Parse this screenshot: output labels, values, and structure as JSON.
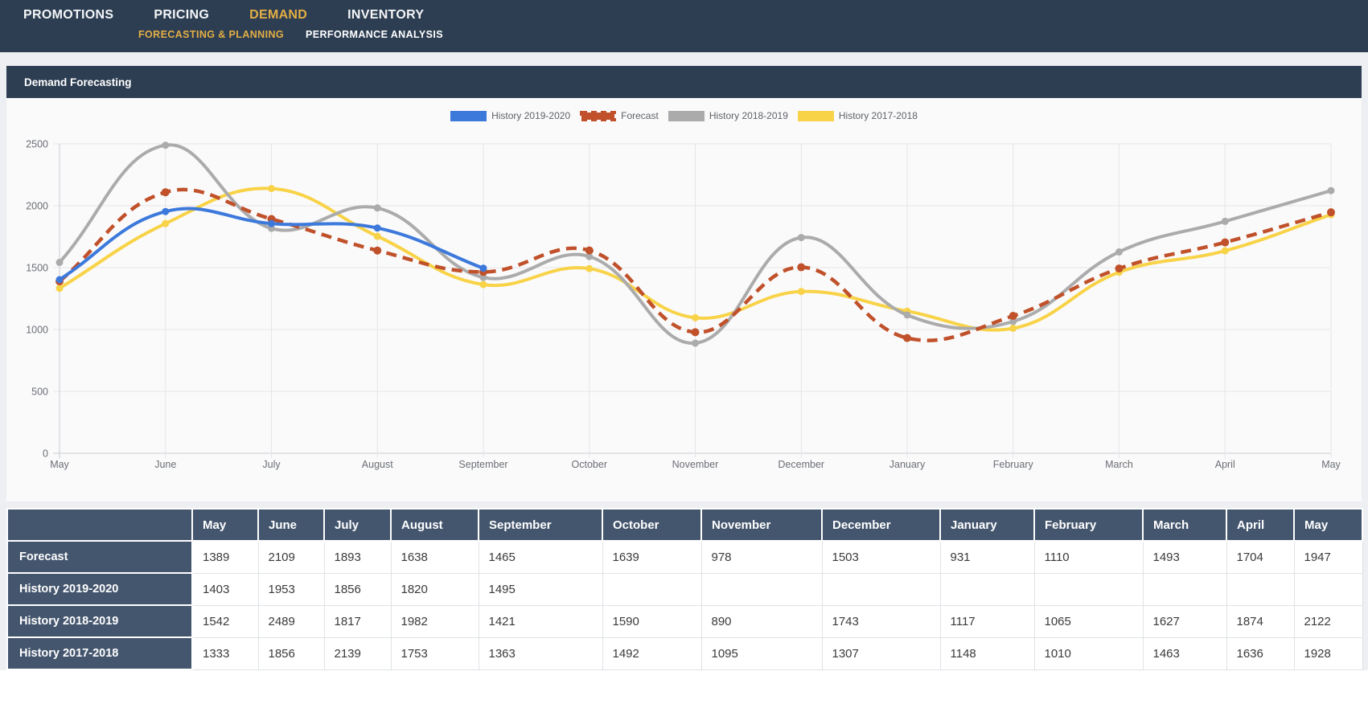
{
  "nav": {
    "items": [
      {
        "label": "PROMOTIONS",
        "active": false
      },
      {
        "label": "PRICING",
        "active": false
      },
      {
        "label": "DEMAND",
        "active": true
      },
      {
        "label": "INVENTORY",
        "active": false
      }
    ],
    "sub_items": [
      {
        "label": "FORECASTING & PLANNING",
        "active": true
      },
      {
        "label": "PERFORMANCE ANALYSIS",
        "active": false
      }
    ]
  },
  "panel": {
    "title": "Demand Forecasting"
  },
  "chart_data": {
    "type": "line",
    "x": [
      "May",
      "June",
      "July",
      "August",
      "September",
      "October",
      "November",
      "December",
      "January",
      "February",
      "March",
      "April",
      "May"
    ],
    "series": [
      {
        "name": "History 2019-2020",
        "color": "#3c79db",
        "dashed": false,
        "values": [
          1403,
          1953,
          1856,
          1820,
          1495,
          null,
          null,
          null,
          null,
          null,
          null,
          null,
          null
        ]
      },
      {
        "name": "Forecast",
        "color": "#c0512a",
        "dashed": true,
        "values": [
          1389,
          2109,
          1893,
          1638,
          1465,
          1639,
          978,
          1503,
          931,
          1110,
          1493,
          1704,
          1947
        ]
      },
      {
        "name": "History 2018-2019",
        "color": "#ababab",
        "dashed": false,
        "values": [
          1542,
          2489,
          1817,
          1982,
          1421,
          1590,
          890,
          1743,
          1117,
          1065,
          1627,
          1874,
          2122
        ]
      },
      {
        "name": "History 2017-2018",
        "color": "#f8d348",
        "dashed": false,
        "values": [
          1333,
          1856,
          2139,
          1753,
          1363,
          1492,
          1095,
          1307,
          1148,
          1010,
          1463,
          1636,
          1928
        ]
      }
    ],
    "ylim": [
      0,
      2500
    ],
    "yticks": [
      0,
      500,
      1000,
      1500,
      2000,
      2500
    ],
    "grid": true,
    "legend_position": "top-center"
  },
  "table": {
    "columns": [
      "",
      "May",
      "June",
      "July",
      "August",
      "September",
      "October",
      "November",
      "December",
      "January",
      "February",
      "March",
      "April",
      "May"
    ],
    "rows": [
      {
        "label": "Forecast",
        "values": [
          1389,
          2109,
          1893,
          1638,
          1465,
          1639,
          978,
          1503,
          931,
          1110,
          1493,
          1704,
          1947
        ]
      },
      {
        "label": "History 2019-2020",
        "values": [
          1403,
          1953,
          1856,
          1820,
          1495,
          null,
          null,
          null,
          null,
          null,
          null,
          null,
          null
        ]
      },
      {
        "label": "History 2018-2019",
        "values": [
          1542,
          2489,
          1817,
          1982,
          1421,
          1590,
          890,
          1743,
          1117,
          1065,
          1627,
          1874,
          2122
        ]
      },
      {
        "label": "History 2017-2018",
        "values": [
          1333,
          1856,
          2139,
          1753,
          1363,
          1492,
          1095,
          1307,
          1148,
          1010,
          1463,
          1636,
          1928
        ]
      }
    ]
  },
  "colors": {
    "navy": "#2d3e52",
    "gold": "#e3ae45",
    "table_header": "#44566e",
    "grid_line": "#e5e6e8",
    "axis_line": "#c9ccd0",
    "tick_text": "#6a6e73"
  }
}
